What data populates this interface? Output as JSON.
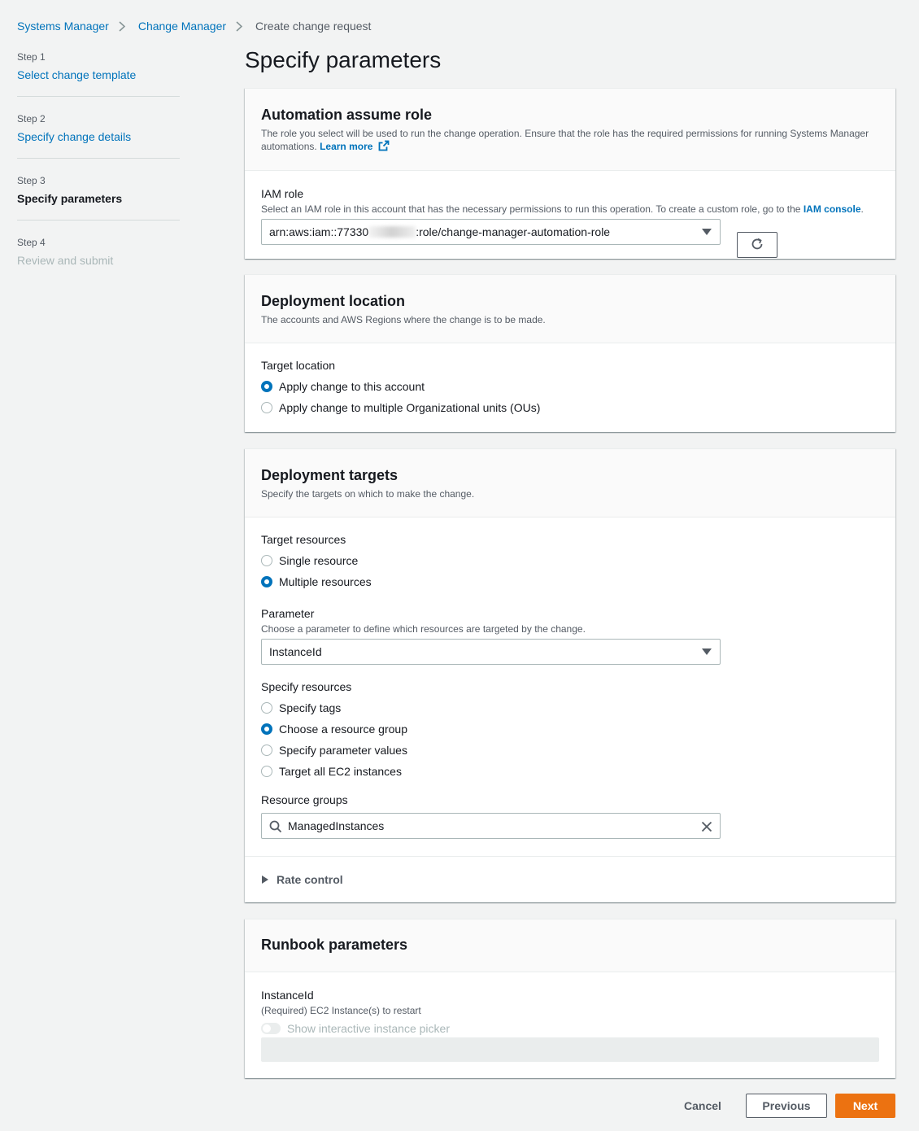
{
  "breadcrumb": {
    "items": [
      "Systems Manager",
      "Change Manager"
    ],
    "current": "Create change request"
  },
  "steps": [
    {
      "num": "Step 1",
      "label": "Select change template",
      "state": "link"
    },
    {
      "num": "Step 2",
      "label": "Specify change details",
      "state": "link"
    },
    {
      "num": "Step 3",
      "label": "Specify parameters",
      "state": "active"
    },
    {
      "num": "Step 4",
      "label": "Review and submit",
      "state": "disabled"
    }
  ],
  "page_title": "Specify parameters",
  "automation": {
    "title": "Automation assume role",
    "desc": "The role you select will be used to run the change operation. Ensure that the role has the required permissions for running Systems Manager automations.",
    "learn_more": "Learn more",
    "iam_label": "IAM role",
    "iam_desc": "Select an IAM role in this account that has the necessary permissions to run this operation. To create a custom role, go to the",
    "iam_console": "IAM console",
    "role_prefix": "arn:aws:iam::77330",
    "role_suffix": ":role/change-manager-automation-role"
  },
  "deployment_location": {
    "title": "Deployment location",
    "desc": "The accounts and AWS Regions where the change is to be made.",
    "target_label": "Target location",
    "options": [
      "Apply change to this account",
      "Apply change to multiple Organizational units (OUs)"
    ],
    "selected": 0
  },
  "deployment_targets": {
    "title": "Deployment targets",
    "desc": "Specify the targets on which to make the change.",
    "resources_label": "Target resources",
    "resource_options": [
      "Single resource",
      "Multiple resources"
    ],
    "resource_selected": 1,
    "parameter_label": "Parameter",
    "parameter_desc": "Choose a parameter to define which resources are targeted by the change.",
    "parameter_value": "InstanceId",
    "specify_label": "Specify resources",
    "specify_options": [
      "Specify tags",
      "Choose a resource group",
      "Specify parameter values",
      "Target all EC2 instances"
    ],
    "specify_selected": 1,
    "groups_label": "Resource groups",
    "groups_value": "ManagedInstances",
    "rate_control": "Rate control"
  },
  "runbook": {
    "title": "Runbook parameters",
    "field_label": "InstanceId",
    "field_desc": "(Required) EC2 Instance(s) to restart",
    "toggle_label": "Show interactive instance picker"
  },
  "footer": {
    "cancel": "Cancel",
    "previous": "Previous",
    "next": "Next"
  },
  "colors": {
    "link": "#0073bb",
    "primary": "#ec7211",
    "background": "#f2f3f3"
  }
}
